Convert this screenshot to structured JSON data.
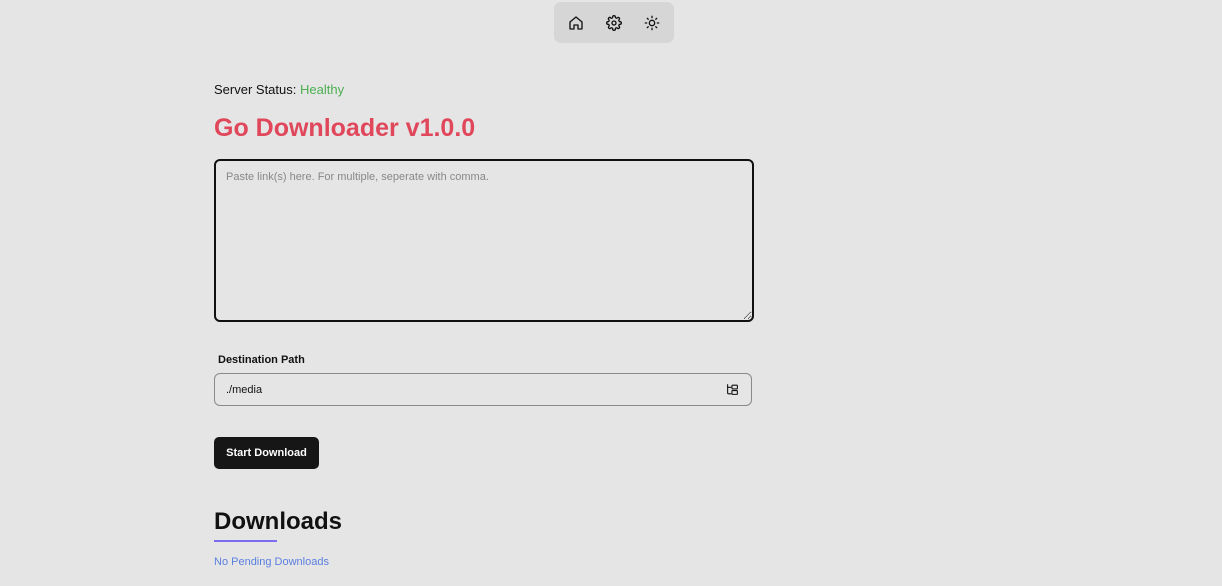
{
  "nav": {
    "items": [
      {
        "icon": "home-icon"
      },
      {
        "icon": "gear-icon"
      },
      {
        "icon": "sun-icon"
      }
    ]
  },
  "status": {
    "label": "Server Status:",
    "value": "Healthy",
    "value_color": "#4caf50"
  },
  "app": {
    "title": "Go Downloader v1.0.0",
    "title_color": "#e0475b"
  },
  "links": {
    "placeholder": "Paste link(s) here. For multiple, seperate with comma.",
    "value": ""
  },
  "destination": {
    "label": "Destination Path",
    "value": "./media",
    "icon": "folder-tree-icon"
  },
  "actions": {
    "start_label": "Start Download"
  },
  "downloads": {
    "heading": "Downloads",
    "empty_message": "No Pending Downloads",
    "accent_color": "#7c6cf0"
  }
}
